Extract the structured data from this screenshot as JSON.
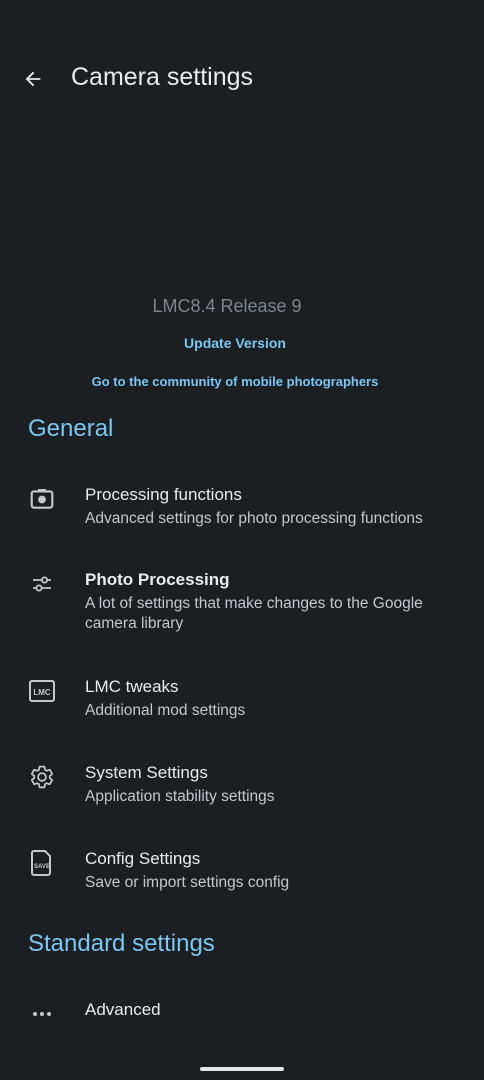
{
  "header": {
    "title": "Camera settings"
  },
  "about": {
    "version": "LMC8.4 Release 9",
    "update_link": "Update Version",
    "community_link": "Go to the community of mobile photographers"
  },
  "sections": {
    "general": "General",
    "standard": "Standard settings"
  },
  "items": [
    {
      "title": "Processing functions",
      "subtitle": "Advanced settings for photo processing functions",
      "icon": "camera-icon"
    },
    {
      "title": "Photo Processing",
      "subtitle": "A lot of settings that make changes to the Google camera library",
      "icon": "sliders-icon"
    },
    {
      "title": "LMC tweaks",
      "subtitle": "Additional mod settings",
      "icon": "lmc-icon",
      "icon_text": "LMC"
    },
    {
      "title": "System Settings",
      "subtitle": "Application stability settings",
      "icon": "gear-icon"
    },
    {
      "title": "Config Settings",
      "subtitle": "Save or import settings config",
      "icon": "save-file-icon",
      "icon_text": "SAVE"
    }
  ],
  "standard_items": [
    {
      "title": "Advanced",
      "icon": "more-horizontal-icon"
    }
  ],
  "colors": {
    "background": "#1b1f22",
    "accent": "#7cc6f2",
    "primary_text": "#e9ecee",
    "secondary_text": "#c4c8cc",
    "muted_text": "#7e8489"
  }
}
